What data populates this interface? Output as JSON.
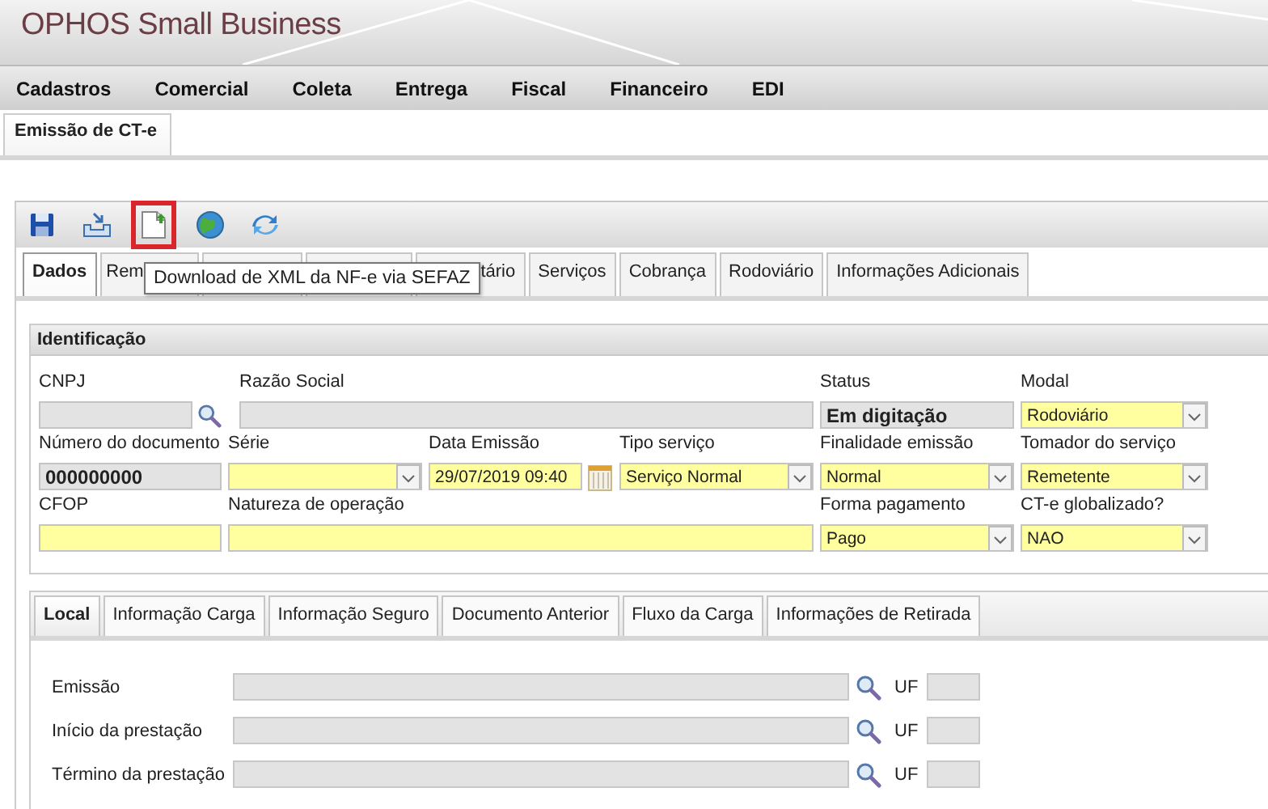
{
  "app": {
    "title": "OPHOS Small Business"
  },
  "menu": [
    "Cadastros",
    "Comercial",
    "Coleta",
    "Entrega",
    "Fiscal",
    "Financeiro",
    "EDI"
  ],
  "page_tabs": [
    {
      "label": "Emissão de CT-e",
      "selected": true
    }
  ],
  "toolbar": [
    {
      "kind": "save",
      "highlighted": false
    },
    {
      "kind": "import",
      "highlighted": false
    },
    {
      "kind": "download",
      "highlighted": true
    },
    {
      "kind": "globe",
      "highlighted": false
    },
    {
      "kind": "refresh",
      "highlighted": false
    }
  ],
  "tooltip": "Download de XML da NF-e via SEFAZ",
  "tabs": [
    {
      "label": "Dados",
      "selected": true
    },
    {
      "label": "Rem",
      "selected": false,
      "kind": "cut_end"
    },
    {
      "selected": false
    },
    {
      "selected": false
    },
    {
      "label": "tário",
      "selected": false,
      "kind": "cut_start"
    },
    {
      "label": "Serviços",
      "selected": false
    },
    {
      "label": "Cobrança",
      "selected": false
    },
    {
      "label": "Rodoviário",
      "selected": false
    },
    {
      "label": "Informações Adicionais",
      "selected": false
    }
  ],
  "identification": {
    "title": "Identificação",
    "rows": [
      [
        {
          "label": "CNPJ",
          "kind": "lookup",
          "disabled": true
        },
        {
          "label": "Razão Social",
          "kind": "text",
          "disabled": true
        },
        {
          "label": "Status",
          "kind": "text",
          "disabled": true,
          "value": "Em digitação"
        },
        {
          "label": "Modal",
          "kind": "select",
          "disabled": false,
          "value": "Rodoviário"
        }
      ],
      [
        {
          "label": "Número do documento",
          "kind": "text",
          "disabled": true,
          "value": "000000000"
        },
        {
          "label": "Série",
          "kind": "select",
          "disabled": false
        },
        {
          "label": "Data Emissão",
          "kind": "date",
          "disabled": false,
          "value": "29/07/2019 09:40"
        },
        {
          "label": "Tipo serviço",
          "kind": "select",
          "disabled": false,
          "value": "Serviço Normal"
        },
        {
          "label": "Finalidade emissão",
          "kind": "select",
          "disabled": false,
          "value": "Normal"
        },
        {
          "label": "Tomador do serviço",
          "kind": "select",
          "disabled": false,
          "value": "Remetente"
        }
      ],
      [
        {
          "label": "CFOP",
          "kind": "text",
          "disabled": false
        },
        {
          "label": "Natureza de operação",
          "kind": "text",
          "disabled": false
        },
        {
          "label": "Forma pagamento",
          "kind": "select",
          "disabled": false,
          "value": "Pago"
        },
        {
          "label": "CT-e globalizado?",
          "kind": "select",
          "disabled": false,
          "value": "NAO"
        }
      ]
    ]
  },
  "sub_tabs": [
    {
      "label": "Local",
      "selected": true
    },
    {
      "label": "Informação Carga",
      "selected": false
    },
    {
      "label": "Informação Seguro",
      "selected": false
    },
    {
      "label": "Documento Anterior",
      "selected": false
    },
    {
      "label": "Fluxo da Carga",
      "selected": false
    },
    {
      "label": "Informações de Retirada",
      "selected": false
    }
  ],
  "local": [
    {
      "label": "Emissão",
      "uf_label": "UF"
    },
    {
      "label": "Início da prestação",
      "uf_label": "UF"
    },
    {
      "label": "Término da prestação",
      "uf_label": "UF"
    }
  ]
}
